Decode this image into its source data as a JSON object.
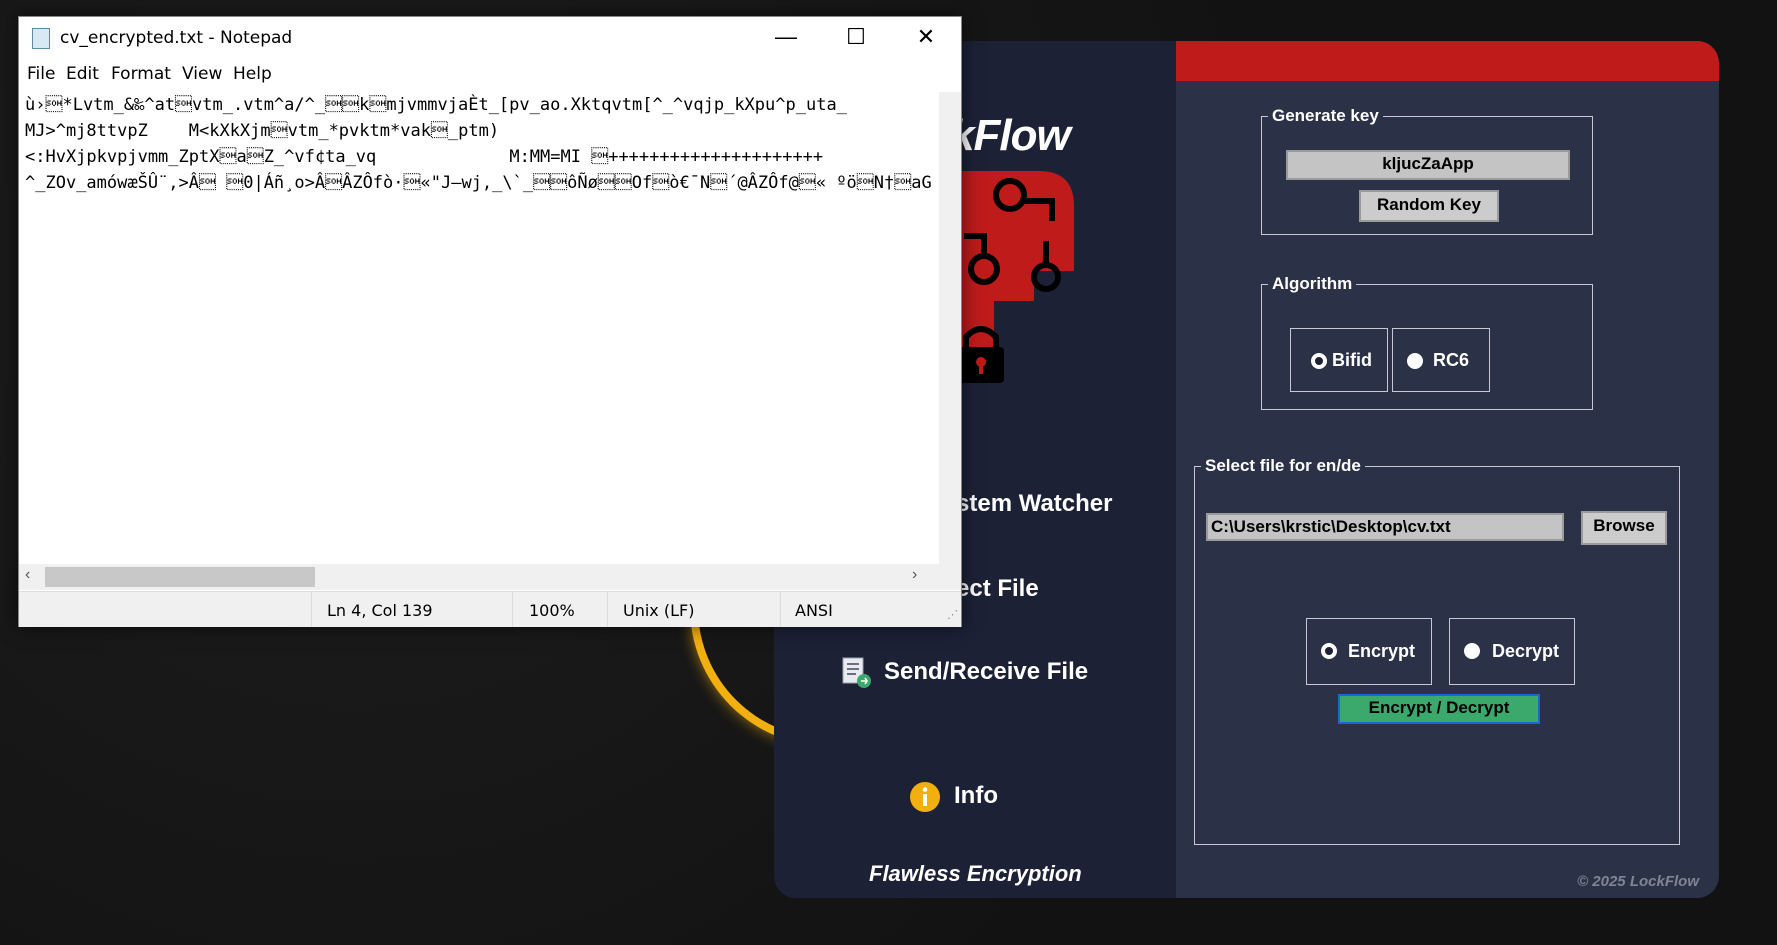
{
  "notepad": {
    "title": "cv_encrypted.txt - Notepad",
    "controls": {
      "minimize": "—",
      "maximize": "☐",
      "close": "✕"
    },
    "menu": [
      "File",
      "Edit",
      "Format",
      "View",
      "Help"
    ],
    "lines": [
      "ù›\u0001*Lvtm_&‰^at\u0001vtm_.vtm^a/^_\u0001\u0001k\u0001mjvmmvjaÈt_[pv_ao.Xktqvtm[^_^vqjp_kXpu^p_uta_",
      "MJ>^mj8ttvpZ    M<kXkXjm\u0001vtm_*pvktm*vak\u0001_ptm)",
      "<:HvXjpkvpjvmm_ZptX\u0001a\u0001Z_^vf¢ta_vq             M:MM=MI \u0001+++++++++++++++++++++",
      "^_ZOv_amówæŠÛ¨,>Â\u0001 \u00010|Áñ¸o>Â\u0001ÂZÔfò·\u0001«\"J—wj,_\\`_\u0001\u0001ôÑø\u0001\u0001Of\u0001ò€¯N\u0001´@ÂZÔf@\u0001« ºö\u0001N†\u0001aGa@"
    ],
    "status": {
      "position": "Ln 4, Col 139",
      "zoom": "100%",
      "eol": "Unix (LF)",
      "encoding": "ANSI"
    }
  },
  "app": {
    "brand": "LockFlow",
    "brand_visible": "kFlow",
    "nav": {
      "watcher": "stem Watcher",
      "select": "ect File",
      "send": "Send/Receive File",
      "info": "Info"
    },
    "tagline": "Flawless Encryption",
    "copyright": "© 2025 LockFlow",
    "generate_key": {
      "legend": "Generate key",
      "value": "kljucZaApp",
      "button": "Random Key"
    },
    "algorithm": {
      "legend": "Algorithm",
      "options": [
        "Bifid",
        "RC6"
      ],
      "selected": "Bifid"
    },
    "file": {
      "legend": "Select file for en/de",
      "path": "C:\\Users\\krstic\\Desktop\\cv.txt",
      "browse": "Browse",
      "modes": [
        "Encrypt",
        "Decrypt"
      ],
      "selected_mode": "Encrypt",
      "action": "Encrypt / Decrypt"
    },
    "colors": {
      "red": "#bf1b1b",
      "left_panel": "#1c2136",
      "right_panel": "#2b3146",
      "green_button": "#3aa96b",
      "info_icon": "#f2b010"
    }
  }
}
